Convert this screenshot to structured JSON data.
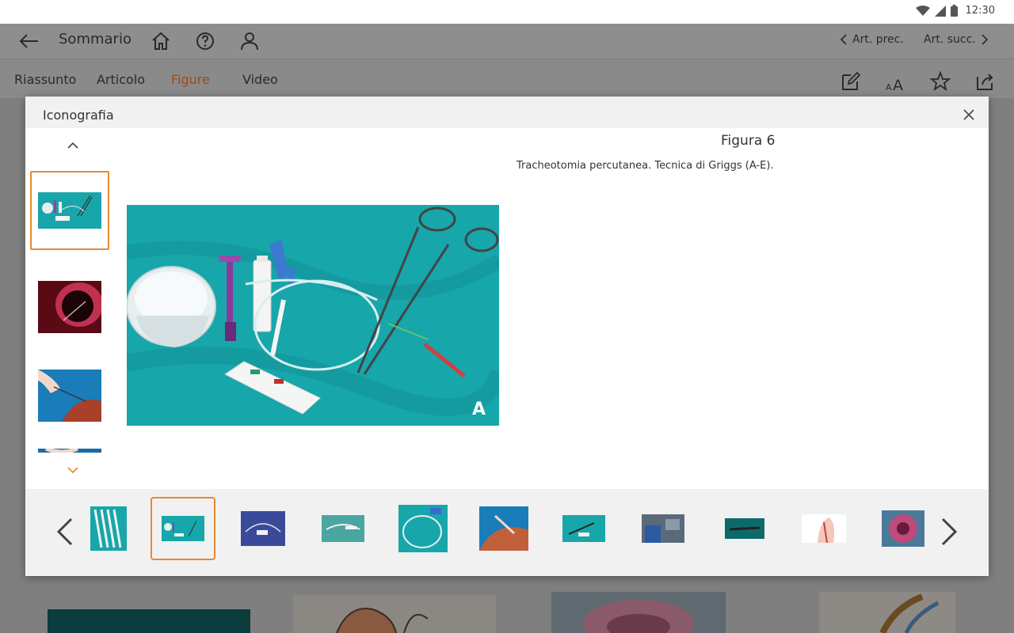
{
  "status_bar": {
    "time": "12:30",
    "icons": [
      "wifi-icon",
      "signal-icon",
      "battery-icon"
    ]
  },
  "app_bar": {
    "title": "Sommario",
    "prev_label": "Art. prec.",
    "next_label": "Art. succ."
  },
  "tabs": [
    {
      "label": "Riassunto",
      "active": false
    },
    {
      "label": "Articolo",
      "active": false
    },
    {
      "label": "Figure",
      "active": true
    },
    {
      "label": "Video",
      "active": false
    }
  ],
  "modal": {
    "title": "Iconografia",
    "figure_number": "Figura 6",
    "caption": "Tracheotomia percutanea. Tecnica di Griggs (A-E).",
    "image_letter": "A"
  },
  "colors": {
    "accent": "#e68a2e",
    "active_tab": "#a24a10",
    "surgical_drape": "#17a6aa"
  }
}
